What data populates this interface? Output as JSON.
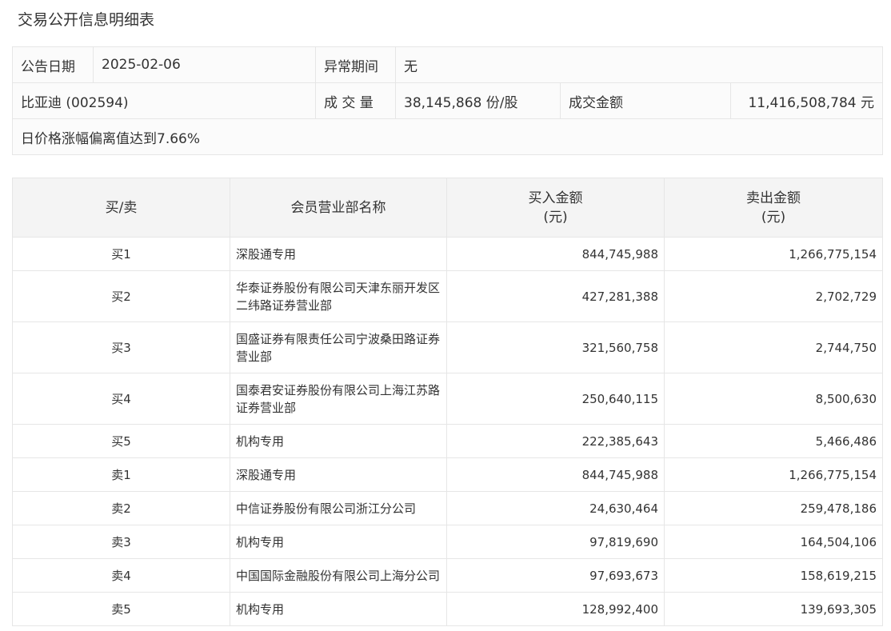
{
  "title": "交易公开信息明细表",
  "info": {
    "date_label": "公告日期",
    "date_value": "2025-02-06",
    "abnormal_label": "异常期间",
    "abnormal_value": "无",
    "stock": "比亚迪 (002594)",
    "volume_label": "成 交 量",
    "volume_value": "38,145,868 份/股",
    "amount_label": "成交金额",
    "amount_value": "11,416,508,784 元",
    "reason": "日价格涨幅偏离值达到7.66%"
  },
  "table": {
    "headers": {
      "side": "买/卖",
      "name": "会员营业部名称",
      "buy_line1": "买入金额",
      "buy_line2": "(元)",
      "sell_line1": "卖出金额",
      "sell_line2": "(元)"
    },
    "rows": [
      {
        "side": "买1",
        "name_line1": "深股通专用",
        "name_line2": "",
        "buy": "844,745,988",
        "sell": "1,266,775,154"
      },
      {
        "side": "买2",
        "name_line1": "华泰证券股份有限公司天津东丽开发区",
        "name_line2": "二纬路证券营业部",
        "buy": "427,281,388",
        "sell": "2,702,729"
      },
      {
        "side": "买3",
        "name_line1": "国盛证券有限责任公司宁波桑田路证券",
        "name_line2": "营业部",
        "buy": "321,560,758",
        "sell": "2,744,750"
      },
      {
        "side": "买4",
        "name_line1": "国泰君安证券股份有限公司上海江苏路",
        "name_line2": "证券营业部",
        "buy": "250,640,115",
        "sell": "8,500,630"
      },
      {
        "side": "买5",
        "name_line1": "机构专用",
        "name_line2": "",
        "buy": "222,385,643",
        "sell": "5,466,486"
      },
      {
        "side": "卖1",
        "name_line1": "深股通专用",
        "name_line2": "",
        "buy": "844,745,988",
        "sell": "1,266,775,154"
      },
      {
        "side": "卖2",
        "name_line1": "中信证券股份有限公司浙江分公司",
        "name_line2": "",
        "buy": "24,630,464",
        "sell": "259,478,186"
      },
      {
        "side": "卖3",
        "name_line1": "机构专用",
        "name_line2": "",
        "buy": "97,819,690",
        "sell": "164,504,106"
      },
      {
        "side": "卖4",
        "name_line1": "中国国际金融股份有限公司上海分公司",
        "name_line2": "",
        "buy": "97,693,673",
        "sell": "158,619,215"
      },
      {
        "side": "卖5",
        "name_line1": "机构专用",
        "name_line2": "",
        "buy": "128,992,400",
        "sell": "139,693,305"
      }
    ]
  }
}
